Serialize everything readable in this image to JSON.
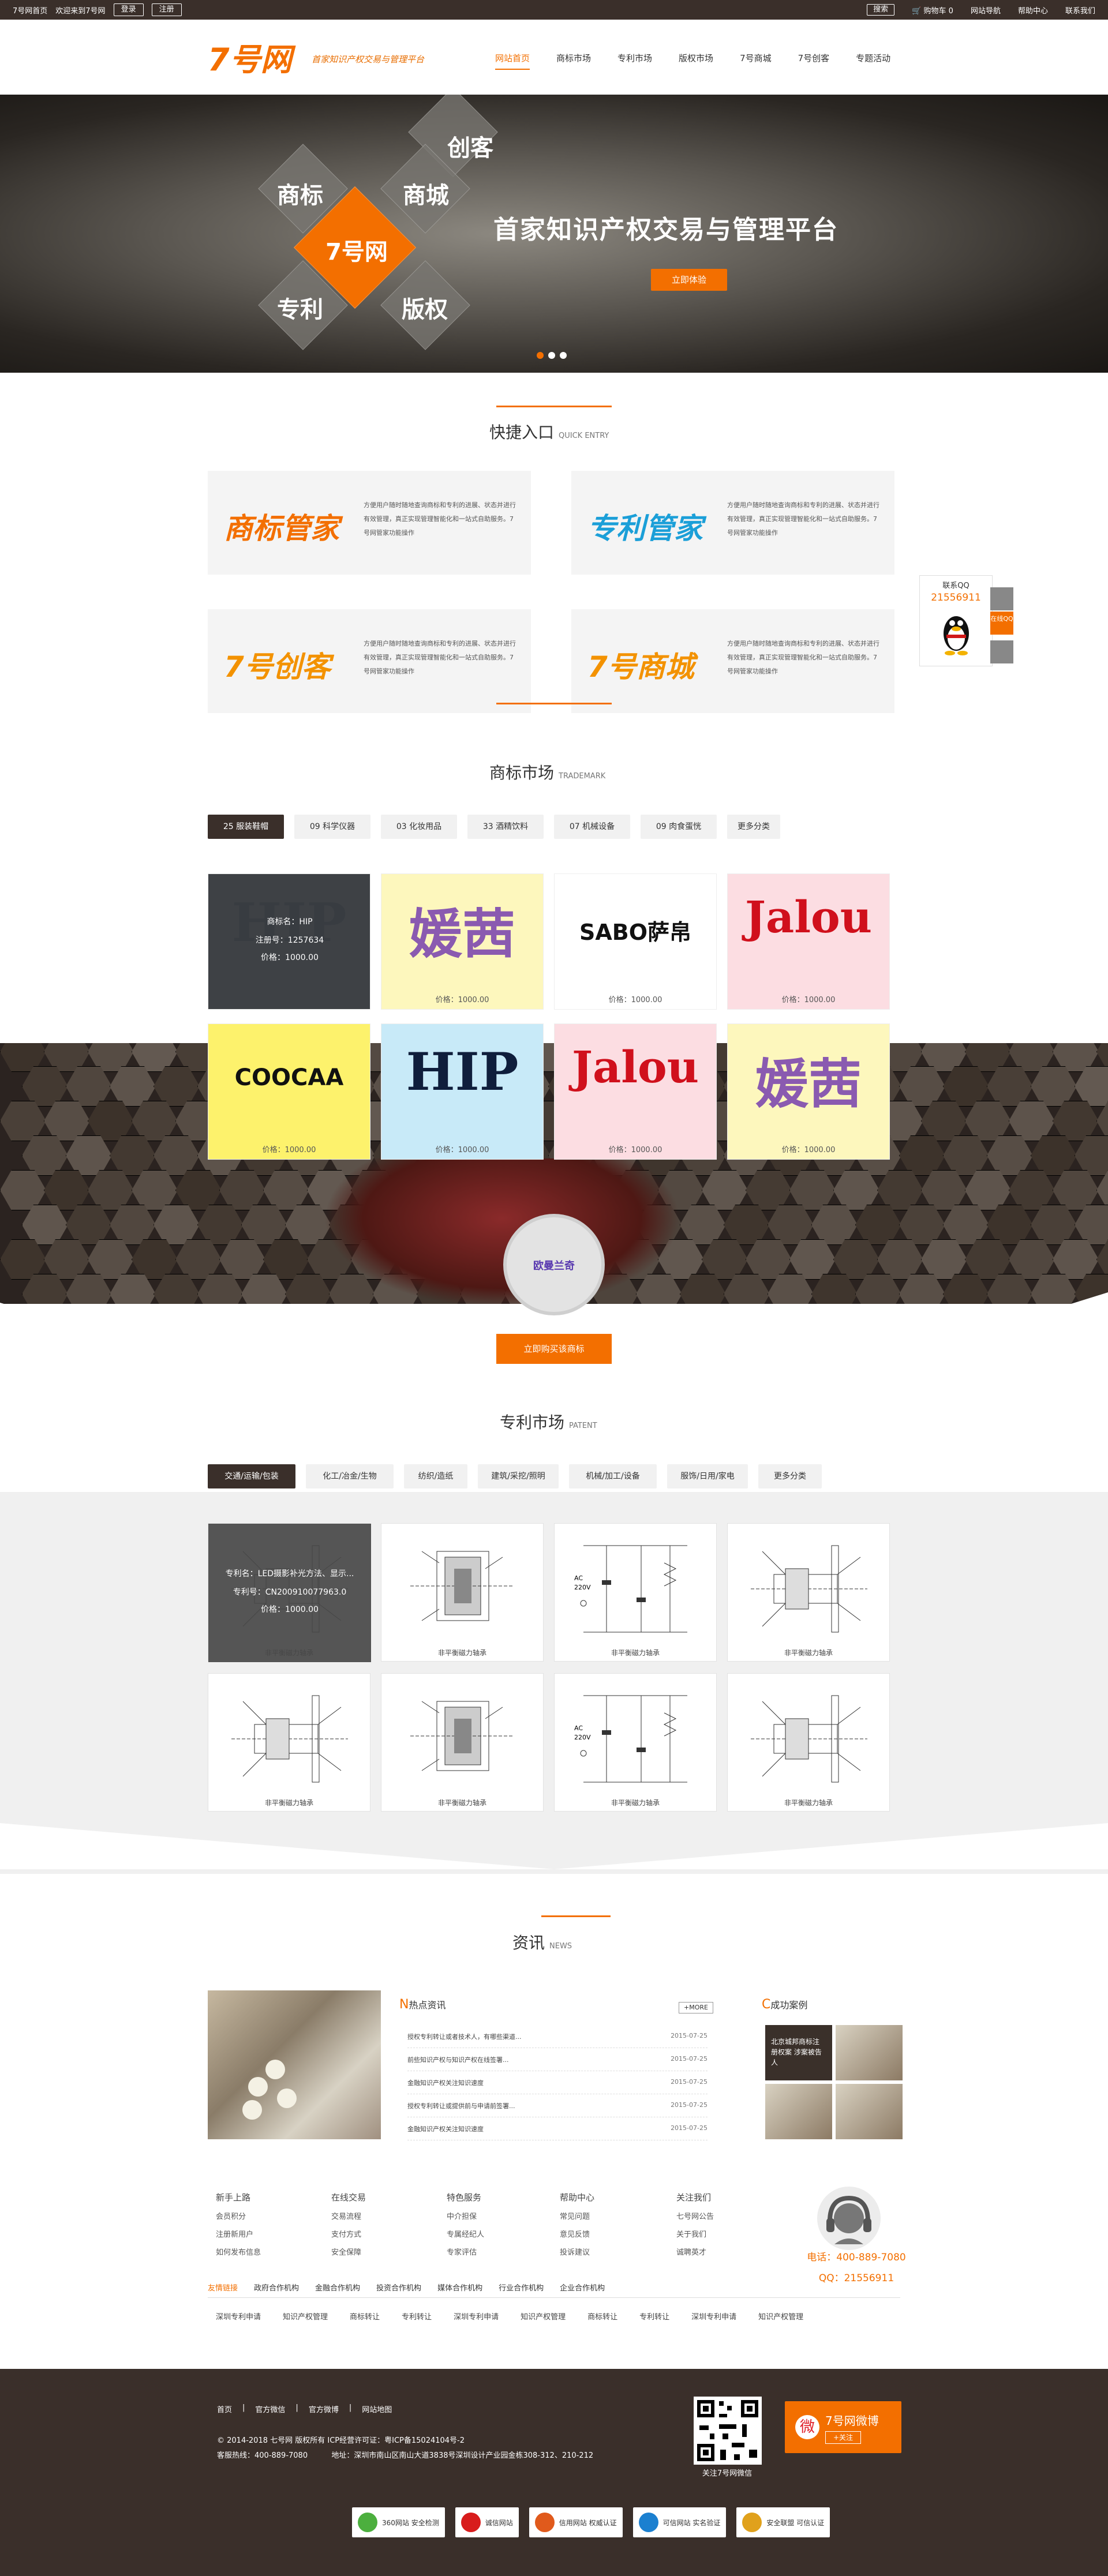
{
  "topbar": {
    "home": "7号网首页",
    "welcome": "欢迎来到7号网",
    "login": "登录",
    "register": "注册",
    "search": "搜索",
    "cart": "购物车 0",
    "sitenav": "网站导航",
    "help": "帮助中心",
    "contact": "联系我们"
  },
  "logo": {
    "main": "7号网",
    "tagline": "首家知识产权交易与管理平台"
  },
  "nav": [
    "网站首页",
    "商标市场",
    "专利市场",
    "版权市场",
    "7号商城",
    "7号创客",
    "专题活动"
  ],
  "banner": {
    "words": [
      "创客",
      "商标",
      "商城",
      "7号网",
      "专利",
      "版权"
    ],
    "title": "首家知识产权交易与管理平台",
    "button": "立即体验"
  },
  "quick": {
    "title": "快捷入口",
    "subtitle": "QUICK ENTRY",
    "items": [
      {
        "name": "商标管家",
        "color": "#f36f00",
        "desc": "方便用户随时随地查询商标和专利的进展、状态并进行有效管理，真正实现管理智能化和一站式自助服务。7号网管家功能操作"
      },
      {
        "name": "专利管家",
        "color": "#1b9fd8",
        "desc": "方便用户随时随地查询商标和专利的进展、状态并进行有效管理，真正实现管理智能化和一站式自助服务。7号网管家功能操作"
      },
      {
        "name": "7号创客",
        "color": "#f39200",
        "desc": "方便用户随时随地查询商标和专利的进展、状态并进行有效管理，真正实现管理智能化和一站式自助服务。7号网管家功能操作"
      },
      {
        "name": "7号商城",
        "color": "#f39200",
        "desc": "方便用户随时随地查询商标和专利的进展、状态并进行有效管理，真正实现管理智能化和一站式自助服务。7号网管家功能操作"
      }
    ]
  },
  "float": {
    "label": "联系QQ",
    "qq": "21556911",
    "side_top": "",
    "side_qq": "在线QQ",
    "side_wx": ""
  },
  "trademark": {
    "title": "商标市场",
    "subtitle": "TRADEMARK",
    "tabs": [
      "25 服装鞋帽",
      "09 科学仪器",
      "03 化妆用品",
      "33 酒精饮料",
      "07 机械设备",
      "09 肉食蛋恍",
      "更多分类"
    ],
    "hover": {
      "name": "商标名：HIP",
      "reg": "注册号：1257634",
      "price": "价格：1000.00"
    },
    "cards": [
      {
        "mark": "HIP",
        "bg": "#5a6068",
        "fg": "#0f1e3c",
        "price": ""
      },
      {
        "mark": "媛茜",
        "bg": "#fdf7bd",
        "fg": "#8a5ab0",
        "price": "价格：1000.00"
      },
      {
        "mark": "SABO萨帛",
        "bg": "#ffffff",
        "fg": "#111111",
        "price": "价格：1000.00"
      },
      {
        "mark": "Jalou",
        "bg": "#fcdde2",
        "fg": "#d0101c",
        "price": "价格：1000.00"
      },
      {
        "mark": "COOCAA",
        "bg": "#fdf26c",
        "fg": "#111111",
        "price": "价格：1000.00"
      },
      {
        "mark": "HIP",
        "bg": "#c8eaf8",
        "fg": "#0f1e3c",
        "price": "价格：1000.00"
      },
      {
        "mark": "Jalou",
        "bg": "#fcdde2",
        "fg": "#d0101c",
        "price": "价格：1000.00"
      },
      {
        "mark": "媛茜",
        "bg": "#fdf7bd",
        "fg": "#8a5ab0",
        "price": "价格：1000.00"
      }
    ],
    "brand": "欧曼兰奇",
    "button": "立即购买该商标"
  },
  "patent": {
    "title": "专利市场",
    "subtitle": "PATENT",
    "tabs": [
      "交通/运输/包装",
      "化工/冶金/生物",
      "纺织/造纸",
      "建筑/采挖/照明",
      "机械/加工/设备",
      "服饰/日用/家电",
      "更多分类"
    ],
    "hover": {
      "name": "专利名：LED摄影补光方法、显示...",
      "no": "专利号：CN200910077963.0",
      "price": "价格：1000.00"
    },
    "caption": "非平衡磁力轴承"
  },
  "news": {
    "title": "资讯",
    "subtitle": "NEWS",
    "hot_title": "热点资讯",
    "more": "+MORE",
    "hot": [
      {
        "t": "授权专利转让或者技术人，有哪些渠道...",
        "d": "2015-07-25"
      },
      {
        "t": "前些知识产权与知识产权在线签署...",
        "d": "2015-07-25"
      },
      {
        "t": "金融知识产权关注知识速度",
        "d": "2015-07-25"
      },
      {
        "t": "授权专利转让或提供前与申请前签署...",
        "d": "2015-07-25"
      },
      {
        "t": "金融知识产权关注知识速度",
        "d": "2015-07-25"
      }
    ],
    "case_title": "成功案例",
    "case_caption": "北京城邦商标注册权案 涉案被告人"
  },
  "footerLinks": {
    "cols": [
      {
        "h": "新手上路",
        "items": [
          "会员积分",
          "注册新用户",
          "如何发布信息"
        ]
      },
      {
        "h": "在线交易",
        "items": [
          "交易流程",
          "支付方式",
          "安全保障"
        ]
      },
      {
        "h": "特色服务",
        "items": [
          "中介担保",
          "专属经纪人",
          "专家评估"
        ]
      },
      {
        "h": "帮助中心",
        "items": [
          "常见问题",
          "意见反馈",
          "投诉建议"
        ]
      },
      {
        "h": "关注我们",
        "items": [
          "七号网公告",
          "关于我们",
          "诚聘英才"
        ]
      }
    ],
    "tel": "电话：400-889-7080",
    "qq": "QQ：21556911",
    "tabs": [
      "友情链接",
      "政府合作机构",
      "金融合作机构",
      "投资合作机构",
      "媒体合作机构",
      "行业合作机构",
      "企业合作机构"
    ],
    "links": [
      "深圳专利申请",
      "知识产权管理",
      "商标转让",
      "专利转让",
      "深圳专利申请",
      "知识产权管理",
      "商标转让",
      "专利转让",
      "深圳专利申请",
      "知识产权管理"
    ]
  },
  "footer": {
    "nav": [
      "首页",
      "官方微信",
      "官方微博",
      "网站地图"
    ],
    "copy1": "© 2014-2018 七号网 版权所有 ICP经营许可证：粤ICP备15024104号-2",
    "copy2": "客服热线：400-889-7080          地址：深圳市南山区南山大道3838号深圳设计产业园金栋308-312、210-212",
    "qr_label": "关注7号网微信",
    "weibo": "7号网微博",
    "weibo_btn": "+关注",
    "badges": [
      {
        "t": "360网站 安全检测",
        "c": "#4caf3e"
      },
      {
        "t": "诚信网站",
        "c": "#d81c1c"
      },
      {
        "t": "信用网站 权威认证",
        "c": "#e05a1c"
      },
      {
        "t": "可信网站 实名验证",
        "c": "#1b80d0"
      },
      {
        "t": "安全联盟 可信认证",
        "c": "#e0a11c"
      }
    ]
  }
}
